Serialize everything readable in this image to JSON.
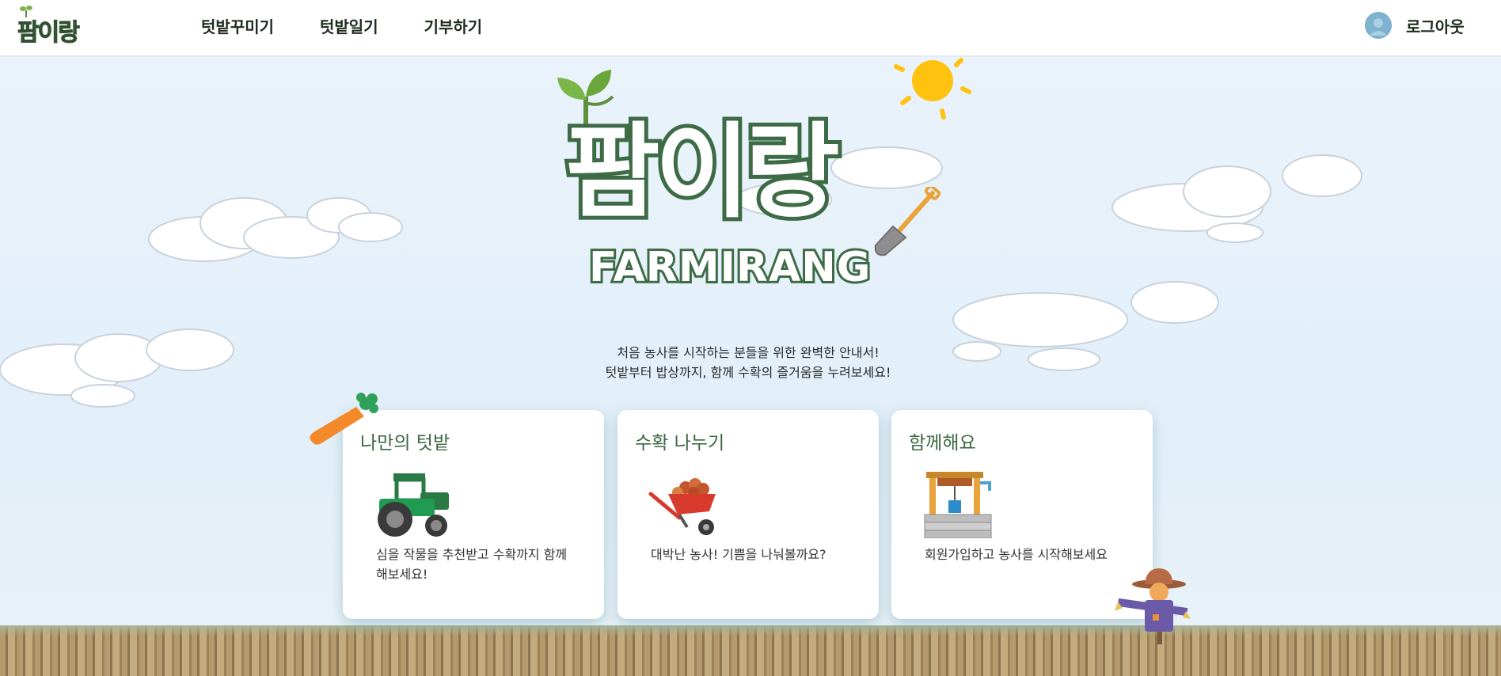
{
  "header": {
    "logo_text": "팜이랑",
    "nav": [
      "텃밭꾸미기",
      "텃밭일기",
      "기부하기"
    ],
    "logout_label": "로그아웃"
  },
  "hero": {
    "title": "팜이랑",
    "subtitle": "FARMIRANG",
    "intro_line1": "처음 농사를 시작하는 분들을 위한 완벽한 안내서!",
    "intro_line2": "텃밭부터 밥상까지, 함께 수확의 즐거움을 누려보세요!"
  },
  "cards": [
    {
      "title": "나만의 텃밭",
      "desc": "심을 작물을 추천받고 수확까지 함께 해보세요!",
      "icon": "tractor-icon"
    },
    {
      "title": "수확 나누기",
      "desc": "대박난 농사! 기쁨을 나눠볼까요?",
      "icon": "wheelbarrow-icon"
    },
    {
      "title": "함께해요",
      "desc": "회원가입하고 농사를 시작해보세요",
      "icon": "well-icon"
    }
  ],
  "colors": {
    "brand_green": "#3d6b45",
    "sky": "#e7f0f7",
    "sun": "#ffc20e"
  }
}
